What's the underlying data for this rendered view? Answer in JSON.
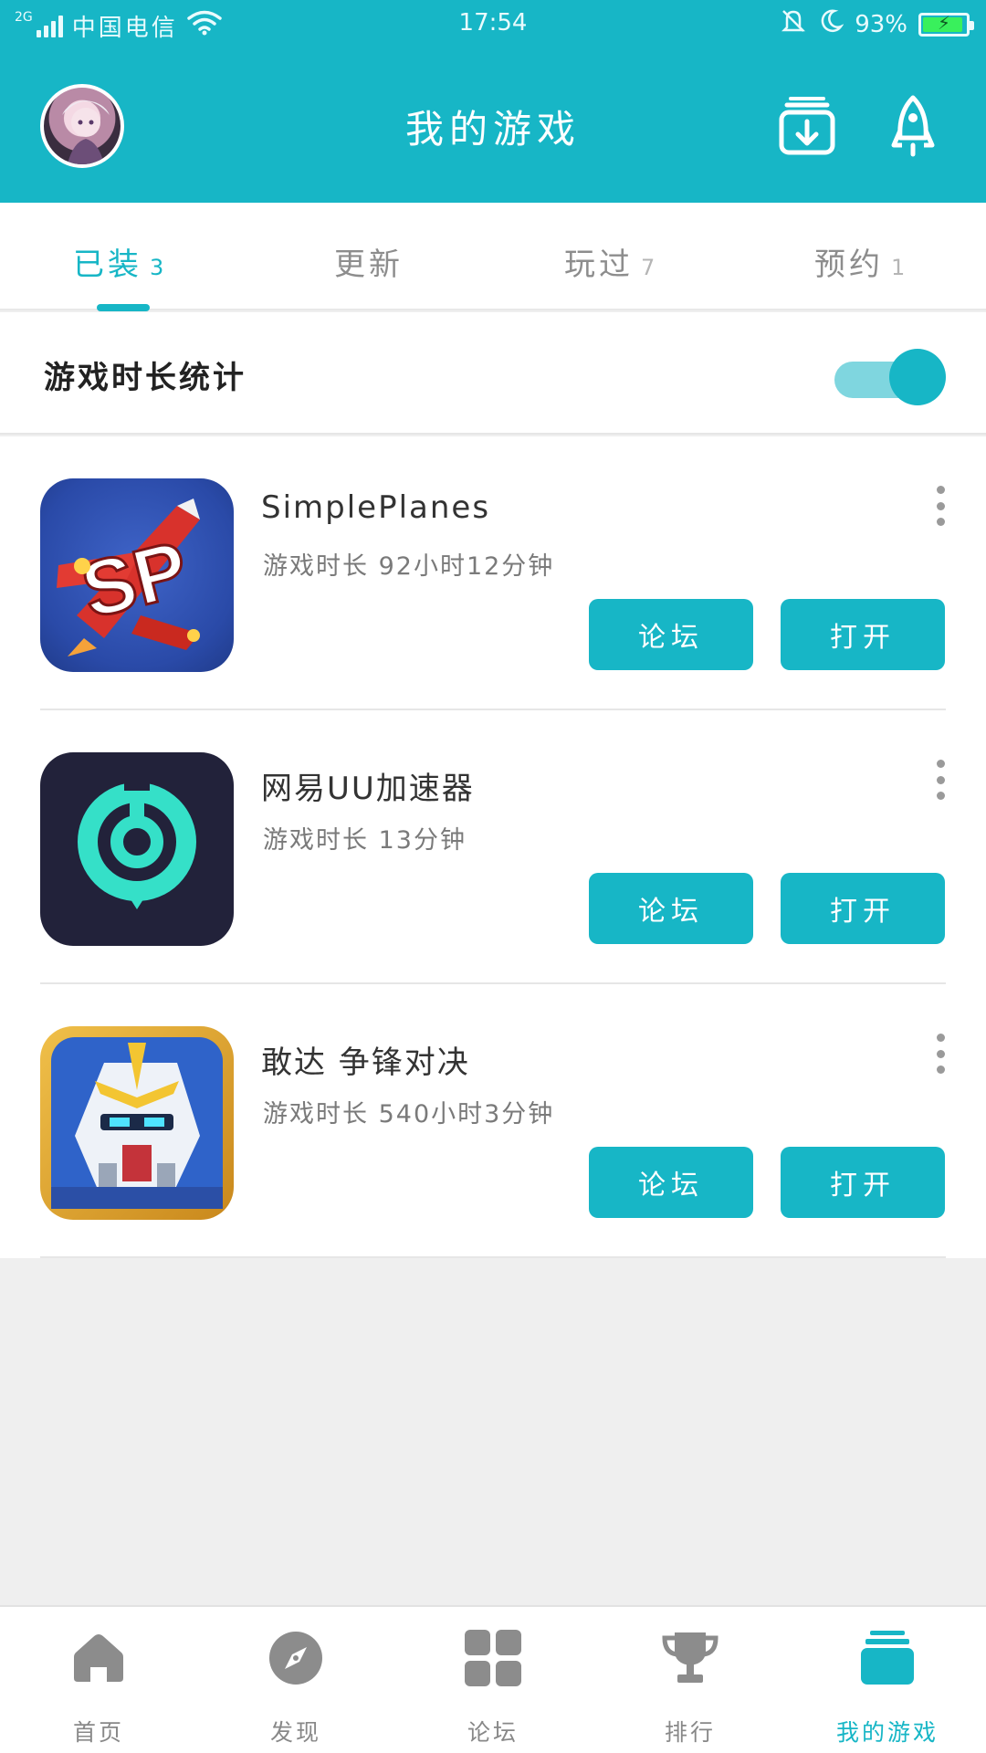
{
  "status_bar": {
    "network_type": "2G",
    "carrier": "中国电信",
    "time": "17:54",
    "battery_percent": "93%",
    "battery_level": 0.93,
    "icons": [
      "signal-icon",
      "wifi-icon",
      "alarm-icon",
      "do-not-disturb-moon-icon",
      "battery-charging-icon"
    ]
  },
  "header": {
    "title": "我的游戏",
    "icons": [
      "avatar",
      "download-manager-icon",
      "rocket-icon"
    ]
  },
  "tabs": [
    {
      "label": "已装",
      "count": "3",
      "active": true
    },
    {
      "label": "更新",
      "count": "",
      "active": false
    },
    {
      "label": "玩过",
      "count": "7",
      "active": false
    },
    {
      "label": "预约",
      "count": "1",
      "active": false
    }
  ],
  "stats": {
    "label": "游戏时长统计",
    "toggle_on": true
  },
  "games": [
    {
      "name": "SimplePlanes",
      "play_time": "游戏时长 92小时12分钟",
      "icon": "simpleplanes-app-icon",
      "forum_label": "论坛",
      "open_label": "打开"
    },
    {
      "name": "网易UU加速器",
      "play_time": "游戏时长 13分钟",
      "icon": "uu-accelerator-app-icon",
      "forum_label": "论坛",
      "open_label": "打开"
    },
    {
      "name": "敢达 争锋对决",
      "play_time": "游戏时长 540小时3分钟",
      "icon": "gundam-app-icon",
      "forum_label": "论坛",
      "open_label": "打开"
    }
  ],
  "bottom_nav": [
    {
      "label": "首页",
      "icon": "home-icon",
      "active": false
    },
    {
      "label": "发现",
      "icon": "compass-icon",
      "active": false
    },
    {
      "label": "论坛",
      "icon": "grid-icon",
      "active": false
    },
    {
      "label": "排行",
      "icon": "trophy-icon",
      "active": false
    },
    {
      "label": "我的游戏",
      "icon": "my-games-icon",
      "active": true
    }
  ],
  "colors": {
    "accent": "#17b6c6",
    "accent_light": "#7fd6df",
    "background": "#efefef",
    "nav_inactive": "#888888"
  }
}
